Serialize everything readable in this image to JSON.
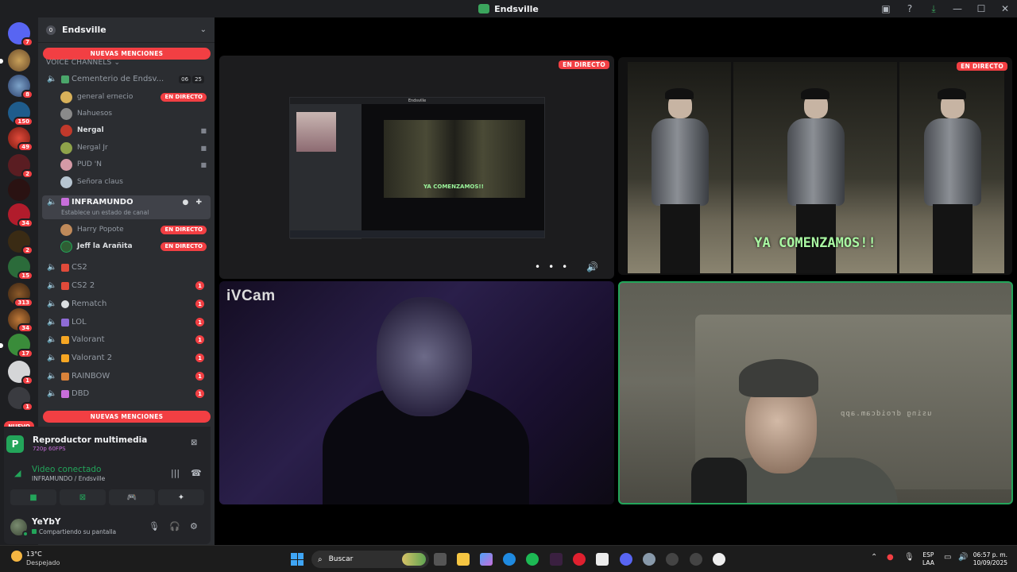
{
  "window": {
    "title": "Endsville"
  },
  "rail": {
    "badges": [
      "7",
      "8",
      "150",
      "49",
      "2",
      "34",
      "2",
      "15",
      "313",
      "34",
      "17",
      "1",
      "1",
      "6"
    ],
    "new_label": "NUEVO"
  },
  "guild": {
    "icon_letter": "0",
    "name": "Endsville",
    "mentions_label": "NUEVAS MENCIONES",
    "category": "VOICE CHANNELS"
  },
  "channels": {
    "cementerio": {
      "name": "Cementerio de Endsv...",
      "count_a": "06",
      "count_b": "25"
    },
    "cementerio_users": [
      {
        "name": "general ernecio",
        "live": "EN DIRECTO"
      },
      {
        "name": "Nahuesos"
      },
      {
        "name": "Nergal"
      },
      {
        "name": "Nergal Jr"
      },
      {
        "name": "PUD 'N"
      },
      {
        "name": "Señora claus"
      }
    ],
    "inframundo": {
      "name": "INFRAMUNDO",
      "status": "Establece un estado de canal"
    },
    "inframundo_users": [
      {
        "name": "Harry Popote",
        "live": "EN DIRECTO"
      },
      {
        "name": "Jeff la Arañita",
        "live": "EN DIRECTO"
      }
    ],
    "list": [
      {
        "name": "CS2",
        "unread": ""
      },
      {
        "name": "CS2 2",
        "unread": "1"
      },
      {
        "name": "Rematch",
        "unread": "1"
      },
      {
        "name": "LOL",
        "unread": "1"
      },
      {
        "name": "Valorant",
        "unread": "1"
      },
      {
        "name": "Valorant 2",
        "unread": "1"
      },
      {
        "name": "RAINBOW",
        "unread": "1"
      },
      {
        "name": "DBD",
        "unread": "1"
      }
    ]
  },
  "media_panel": {
    "icon_letter": "P",
    "title": "Reproductor multimedia",
    "quality": "720p 60FPS"
  },
  "voice_panel": {
    "title": "Video conectado",
    "location": "INFRAMUNDO / Endsville"
  },
  "user": {
    "name": "YeYbY",
    "status": "Compartiendo su pantalla"
  },
  "stage": {
    "live_label": "EN DIRECTO",
    "caption": "YA COMENZAMOS!!",
    "cam_label": "iVCam",
    "watermark": "using droidcam.app",
    "mini_title": "Endsville"
  },
  "taskbar": {
    "temperature": "13°C",
    "weather": "Despejado",
    "search": "Buscar",
    "lang_top": "ESP",
    "lang_bottom": "LAA",
    "time": "06:57 p. m.",
    "date": "10/09/2025"
  },
  "colors": {
    "accent_red": "#f23f43",
    "accent_green": "#23a55a",
    "sidebar": "#2b2d31",
    "rail": "#1e1f22"
  },
  "icons": [
    "discord-icon",
    "speaker-icon",
    "camera-icon",
    "chat-icon",
    "settings-icon",
    "microphone-icon",
    "headphones-icon",
    "windows-icon",
    "search-icon"
  ]
}
